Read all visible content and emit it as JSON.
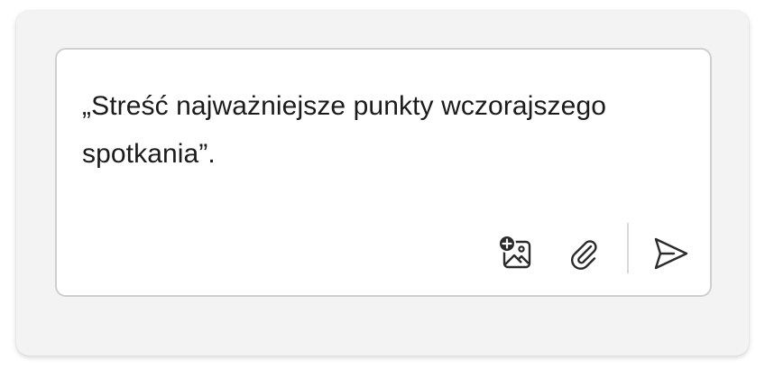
{
  "prompt": {
    "text": "„Streść najważniejsze punkty wczorajszego spotkania”."
  },
  "toolbar": {
    "add_image_icon": "image-add-icon",
    "attach_icon": "paperclip-icon",
    "send_icon": "send-icon"
  },
  "colors": {
    "panel_background": "#f3f3f3",
    "card_background": "#ffffff",
    "card_border": "#cfcfcf",
    "icon_color": "#2b2b2b",
    "text_color": "#1b1b1b"
  }
}
